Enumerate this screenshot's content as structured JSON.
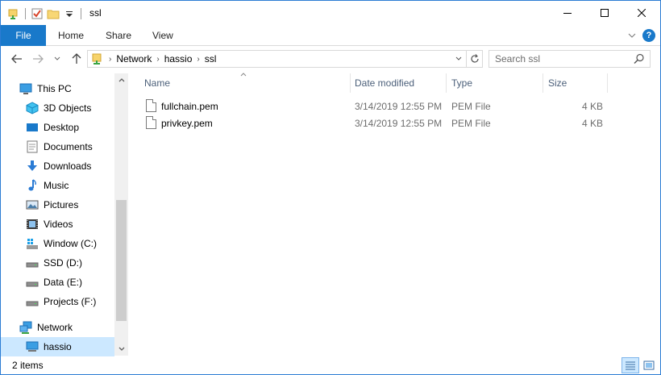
{
  "window": {
    "title": "ssl",
    "controls": {
      "minimize": "—",
      "maximize": "☐",
      "close": "✕"
    }
  },
  "ribbon": {
    "tabs": [
      {
        "label": "File"
      },
      {
        "label": "Home"
      },
      {
        "label": "Share"
      },
      {
        "label": "View"
      }
    ],
    "collapse_icon": "chevron-down-icon",
    "help_label": "?"
  },
  "address": {
    "crumbs": [
      "Network",
      "hassio",
      "ssl"
    ]
  },
  "search": {
    "placeholder": "Search ssl"
  },
  "sidebar": {
    "items": [
      {
        "label": "This PC",
        "icon": "this-pc-icon",
        "level": 0
      },
      {
        "label": "3D Objects",
        "icon": "3d-objects-icon",
        "level": 1
      },
      {
        "label": "Desktop",
        "icon": "desktop-icon",
        "level": 1
      },
      {
        "label": "Documents",
        "icon": "documents-icon",
        "level": 1
      },
      {
        "label": "Downloads",
        "icon": "downloads-icon",
        "level": 1
      },
      {
        "label": "Music",
        "icon": "music-icon",
        "level": 1
      },
      {
        "label": "Pictures",
        "icon": "pictures-icon",
        "level": 1
      },
      {
        "label": "Videos",
        "icon": "videos-icon",
        "level": 1
      },
      {
        "label": "Window (C:)",
        "icon": "windows-drive-icon",
        "level": 1
      },
      {
        "label": "SSD (D:)",
        "icon": "drive-icon",
        "level": 1
      },
      {
        "label": "Data (E:)",
        "icon": "drive-icon",
        "level": 1
      },
      {
        "label": "Projects (F:)",
        "icon": "drive-icon",
        "level": 1
      },
      {
        "label": "Network",
        "icon": "network-icon",
        "level": 0
      },
      {
        "label": "hassio",
        "icon": "computer-icon",
        "level": 1,
        "selected": true
      }
    ]
  },
  "columns": [
    {
      "label": "Name"
    },
    {
      "label": "Date modified"
    },
    {
      "label": "Type"
    },
    {
      "label": "Size"
    }
  ],
  "files": [
    {
      "name": "fullchain.pem",
      "date": "3/14/2019 12:55 PM",
      "type": "PEM File",
      "size": "4 KB"
    },
    {
      "name": "privkey.pem",
      "date": "3/14/2019 12:55 PM",
      "type": "PEM File",
      "size": "4 KB"
    }
  ],
  "status": {
    "count": "2 items"
  },
  "colors": {
    "accent": "#1979ca",
    "selection": "#cce8ff",
    "header_text": "#4c607a"
  }
}
